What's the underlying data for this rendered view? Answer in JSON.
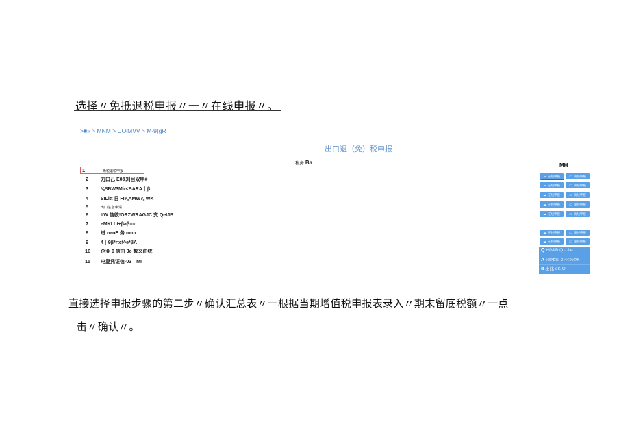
{
  "heading": "选择〃免抵退税申报〃一〃在线申报〃。",
  "breadcrumb": ">■» > MNM > UOiMVV > M-9)gR",
  "panel": {
    "title": "出口退（免）税申报",
    "tax_label_small": "税务",
    "tax_label_bold": "Ba",
    "operation_header": "MH"
  },
  "steps": [
    {
      "num": "1",
      "text": "免税退税申报"
    },
    {
      "num": "2",
      "text": "力口己 E0&刈目双申#"
    },
    {
      "num": "3",
      "text": "⅛SBW3Mir<BARA｜β"
    },
    {
      "num": "4",
      "text": "SILitt 日 FI⅞AMW⅞ WK"
    },
    {
      "num": "5",
      "text": "出口信息'申请"
    },
    {
      "num": "6",
      "text": "ItW 信欲!ORZWRAGJC 究 QeIJB"
    },
    {
      "num": "7",
      "text": "eMKLLt+βaβ≡≡"
    },
    {
      "num": "8",
      "text": "进 naoE 务 mmι"
    },
    {
      "num": "9",
      "text": "4｜9β*rtcf^e*βA"
    },
    {
      "num": "10",
      "text": "企业 0 信由 Je 数义由统"
    },
    {
      "num": "11",
      "text": "电复凭证信·03｜MI"
    }
  ],
  "buttons": {
    "online": {
      "label": "在线申报",
      "icon": "cloud-icon"
    },
    "offline": {
      "label": "离线申报",
      "icon": "monitor-icon"
    }
  },
  "dropdown_menu": [
    {
      "prefix": "Q",
      "text": "HfMIB Q · 3le"
    },
    {
      "prefix": "A",
      "text": "⅛tfΦSi 3 <<⅞ΦK"
    },
    {
      "prefix": "α",
      "text": "出比 eK Q"
    }
  ],
  "paragraph": {
    "line1": "直接选择申报步骤的第二步〃确认汇总表〃一根据当期增值税申报表录入〃期末留底税额〃一点",
    "line2": "击〃确认〃。"
  }
}
